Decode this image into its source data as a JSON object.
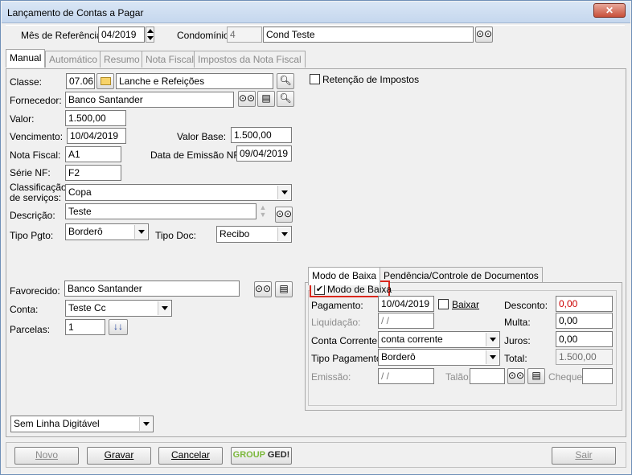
{
  "window": {
    "title": "Lançamento de Contas a Pagar",
    "close_glyph": "✕"
  },
  "header": {
    "mes_label": "Mês de Referência:",
    "mes_value": "04/2019",
    "condominio_label": "Condomínio:",
    "condominio_code": "4",
    "condominio_name": "Cond Teste"
  },
  "tabs": [
    "Manual",
    "Automático",
    "Resumo",
    "Nota Fiscal",
    "Impostos da Nota Fiscal"
  ],
  "form": {
    "classe_label": "Classe:",
    "classe_code": "07.06",
    "classe_name": "Lanche e Refeições",
    "retencao_label": "Retenção de Impostos",
    "fornecedor_label": "Fornecedor:",
    "fornecedor_value": "Banco Santander",
    "valor_label": "Valor:",
    "valor_value": "1.500,00",
    "vencimento_label": "Vencimento:",
    "vencimento_value": "10/04/2019",
    "valor_base_label": "Valor Base:",
    "valor_base_value": "1.500,00",
    "nota_fiscal_label": "Nota Fiscal:",
    "nota_fiscal_value": "A1",
    "data_emissao_label": "Data de Emissão NF:",
    "data_emissao_value": "09/04/2019",
    "serie_label": "Série NF:",
    "serie_value": "F2",
    "classificacao_label_1": "Classificação",
    "classificacao_label_2": "de serviços:",
    "classificacao_value": "Copa",
    "descricao_label": "Descrição:",
    "descricao_value": "Teste",
    "tipo_pgto_label": "Tipo Pgto:",
    "tipo_pgto_value": "Borderô",
    "tipo_doc_label": "Tipo Doc:",
    "tipo_doc_value": "Recibo",
    "favorecido_label": "Favorecido:",
    "favorecido_value": "Banco Santander",
    "conta_label": "Conta:",
    "conta_value": "Teste Cc",
    "parcelas_label": "Parcelas:",
    "parcelas_value": "1",
    "linha_digitavel_value": "Sem Linha Digitável"
  },
  "baixa": {
    "tabs": [
      "Modo de Baixa",
      "Pendência/Controle de Documentos"
    ],
    "modo_label": "Modo de Baixa",
    "pagamento_label": "Pagamento:",
    "pagamento_value": "10/04/2019",
    "baixar_label": "Baixar",
    "desconto_label": "Desconto:",
    "desconto_value": "0,00",
    "liquidacao_label": "Liquidação:",
    "liquidacao_value": " /  /",
    "multa_label": "Multa:",
    "multa_value": "0,00",
    "conta_corrente_label": "Conta Corrente:",
    "conta_corrente_value": "conta corrente",
    "juros_label": "Juros:",
    "juros_value": "0,00",
    "tipo_pagamento_label": "Tipo Pagamento:",
    "tipo_pagamento_value": "Borderô",
    "total_label": "Total:",
    "total_value": "1.500,00",
    "emissao_label": "Emissão:",
    "emissao_value": " /  /",
    "talao_label": "Talão:",
    "cheque_label": "Cheque:"
  },
  "footer": {
    "novo": "Novo",
    "gravar": "Gravar",
    "cancelar": "Cancelar",
    "group_ged_1": "GROUP",
    "group_ged_2": "GED!",
    "sair": "Sair"
  },
  "icons": {
    "binoculars": "binoculars-icon",
    "folder": "folder-icon",
    "magnifier": "magnifier-icon",
    "card": "card-icon",
    "arrows-down": "double-arrow-down-icon"
  },
  "colors": {
    "highlight": "#d9261c",
    "negative_value": "#cc0000"
  }
}
